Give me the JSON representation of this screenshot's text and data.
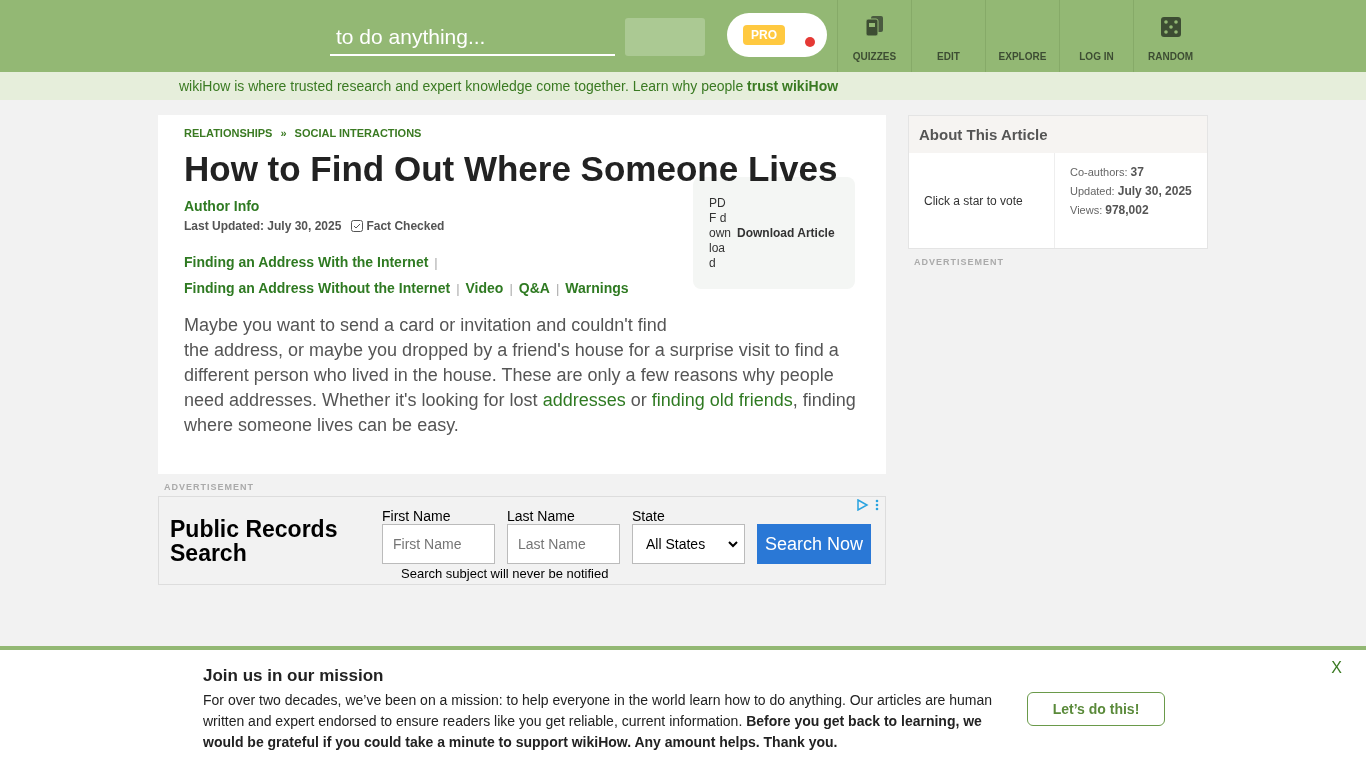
{
  "header": {
    "search": {
      "placeholder": "to do anything..."
    },
    "pro_badge": "PRO",
    "nav": [
      {
        "label": "QUIZZES",
        "kind": "cards"
      },
      {
        "label": "EDIT",
        "kind": "text"
      },
      {
        "label": "EXPLORE",
        "kind": "text"
      },
      {
        "label": "LOG IN",
        "kind": "text"
      },
      {
        "label": "RANDOM",
        "kind": "dice"
      }
    ]
  },
  "trust_bar": {
    "text": "wikiHow is where trusted research and expert knowledge come together. Learn why people ",
    "link": "trust wikiHow"
  },
  "article": {
    "breadcrumbs": [
      "RELATIONSHIPS",
      "SOCIAL INTERACTIONS"
    ],
    "separator": "»",
    "title": "How to Find Out Where Someone Lives",
    "author_info": "Author Info",
    "last_updated": "Last Updated: July 30, 2025",
    "fact_checked": "Fact Checked",
    "download": {
      "image_alt": "PDF download",
      "label": "Download Article"
    },
    "toc_separator": "|",
    "toc": [
      "Finding an Address With the Internet",
      "Finding an Address Without the Internet",
      "Video",
      "Q&A",
      "Warnings"
    ],
    "intro": [
      {
        "text": "Maybe you want to send a card or invitation and couldn't find the address, or maybe you dropped by a friend's house for a surprise visit to find a different person who lived in the house. These are only a few reasons why people need addresses. Whether it's looking for lost ",
        "link": false
      },
      {
        "text": "addresses",
        "link": true
      },
      {
        "text": " or ",
        "link": false
      },
      {
        "text": "finding old friends",
        "link": true
      },
      {
        "text": ", finding where someone lives can be easy.",
        "link": false
      }
    ]
  },
  "ad": {
    "label": "ADVERTISEMENT",
    "title": "Public Records Search",
    "fields": [
      {
        "label": "First Name",
        "placeholder": "First Name"
      },
      {
        "label": "Last Name",
        "placeholder": "Last Name"
      }
    ],
    "state": {
      "label": "State",
      "value": "All States"
    },
    "button": "Search Now",
    "note": "Search subject will never be notified"
  },
  "sidebar": {
    "title": "About This Article",
    "vote": "Click a star to vote",
    "stats": [
      {
        "label": "Co-authors: ",
        "value": "37"
      },
      {
        "label": "Updated: ",
        "value": "July 30, 2025"
      },
      {
        "label": "Views: ",
        "value": "978,002"
      }
    ],
    "ad_label": "ADVERTISEMENT"
  },
  "banner": {
    "title": "Join us in our mission",
    "text": "For over two decades, we’ve been on a mission: to help everyone in the world learn how to do anything. Our articles are human written and expert endorsed to ensure readers like you get reliable, current information. **Before you get back to learning, we would be grateful if you could take a minute to support wikiHow. Any amount helps. Thank you.**",
    "button": "Let’s do this!",
    "close": "X"
  }
}
